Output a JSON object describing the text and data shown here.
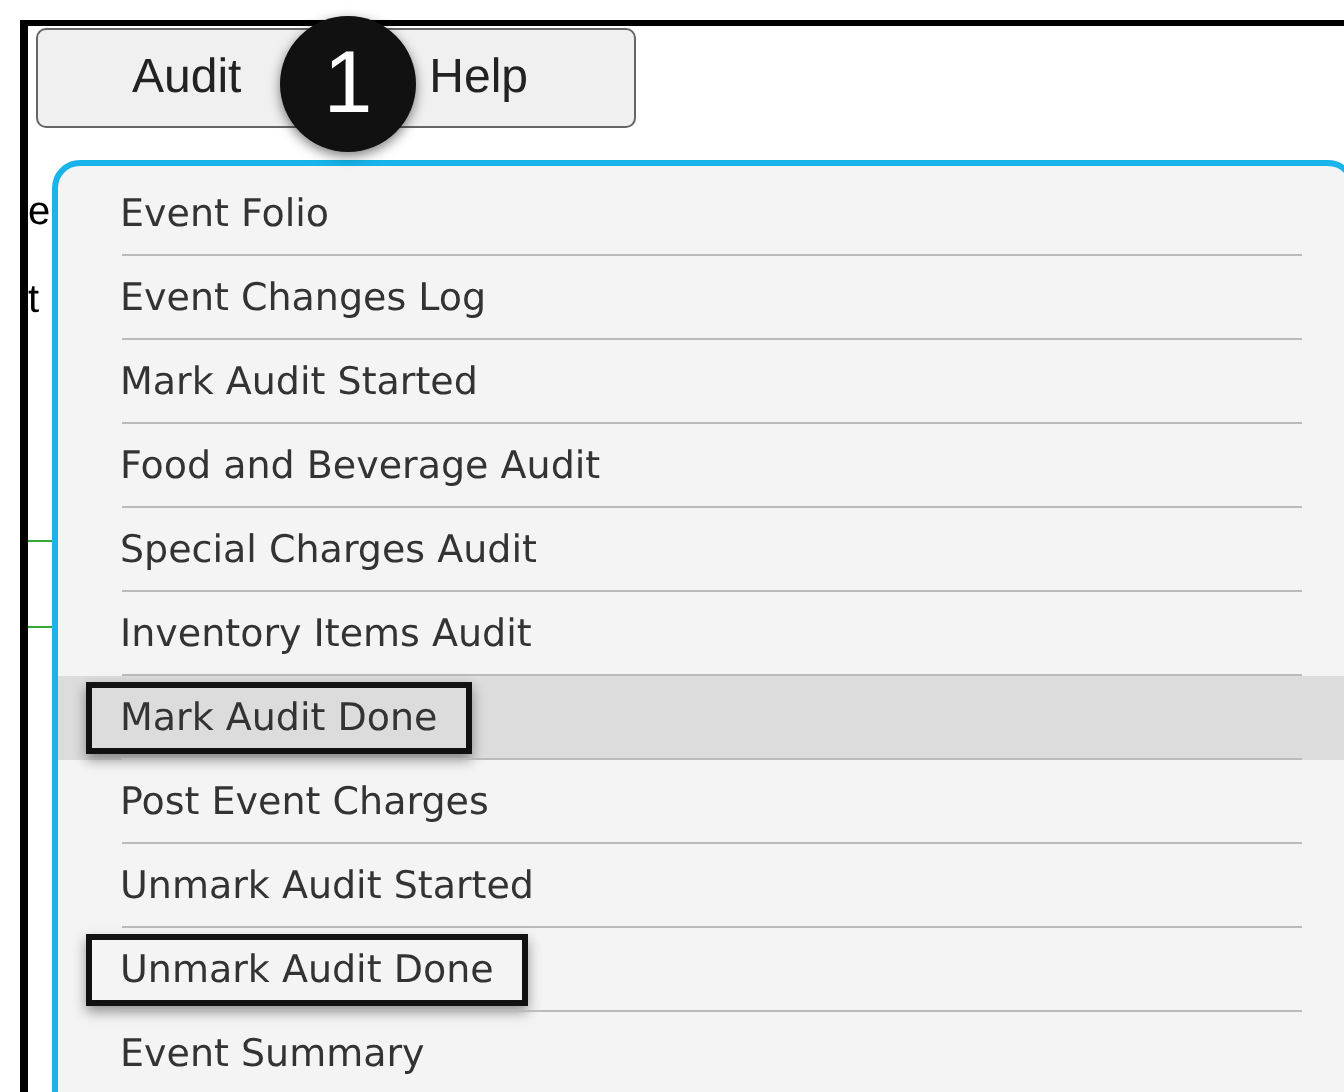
{
  "menubar": [
    {
      "label": "Audit"
    },
    {
      "label": "Help"
    }
  ],
  "step_badge": "1",
  "background_fragments": [
    "e",
    "t"
  ],
  "dropdown": {
    "items": [
      {
        "label": "Event Folio",
        "selected": false,
        "callout": false
      },
      {
        "label": "Event Changes Log",
        "selected": false,
        "callout": false
      },
      {
        "label": "Mark Audit Started",
        "selected": false,
        "callout": false
      },
      {
        "label": "Food and Beverage Audit",
        "selected": false,
        "callout": false
      },
      {
        "label": "Special Charges Audit",
        "selected": false,
        "callout": false
      },
      {
        "label": "Inventory Items Audit",
        "selected": false,
        "callout": false
      },
      {
        "label": "Mark Audit Done",
        "selected": true,
        "callout": true
      },
      {
        "label": "Post Event Charges",
        "selected": false,
        "callout": false
      },
      {
        "label": "Unmark Audit Started",
        "selected": false,
        "callout": false
      },
      {
        "label": "Unmark Audit Done",
        "selected": false,
        "callout": true
      },
      {
        "label": "Event Summary",
        "selected": false,
        "callout": false
      }
    ]
  }
}
